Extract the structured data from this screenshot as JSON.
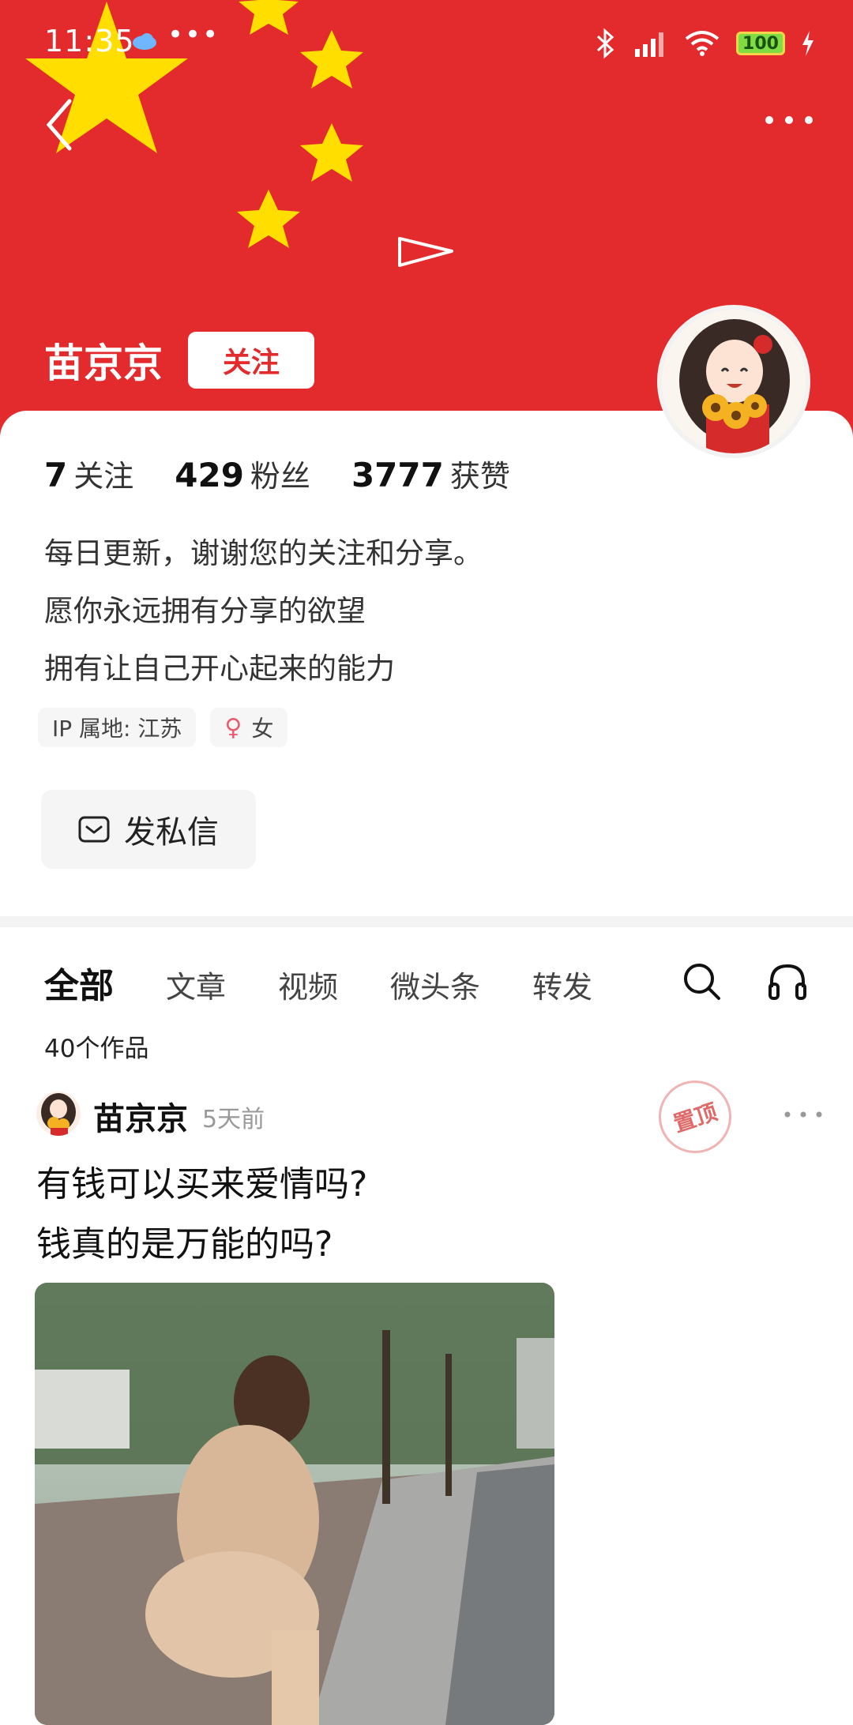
{
  "status_bar": {
    "time": "11:35",
    "dots": "•••",
    "battery": "100"
  },
  "profile": {
    "name": "苗京京",
    "follow_label": "关注",
    "stats": [
      {
        "count": "7",
        "label": "关注"
      },
      {
        "count": "429",
        "label": "粉丝"
      },
      {
        "count": "3777",
        "label": "获赞"
      }
    ],
    "bio": [
      "每日更新，谢谢您的关注和分享。",
      "愿你永远拥有分享的欲望",
      "拥有让自己开心起来的能力"
    ],
    "ip_location": "IP 属地: 江苏",
    "gender": "女",
    "gender_symbol": "♀",
    "dm_label": "发私信"
  },
  "tabs": [
    {
      "label": "全部",
      "active": true
    },
    {
      "label": "文章"
    },
    {
      "label": "视频"
    },
    {
      "label": "微头条"
    },
    {
      "label": "转发"
    }
  ],
  "works_count": "40个作品",
  "post": {
    "author": "苗京京",
    "time": "5天前",
    "pin_label": "置顶",
    "text_lines": [
      "有钱可以买来爱情吗?",
      "钱真的是万能的吗?"
    ]
  },
  "colors": {
    "banner_red": "#e32a2c",
    "star_yellow": "#ffde00",
    "pin_red": "#e06a6a"
  },
  "icons": [
    "back-icon",
    "more-icon",
    "share-icon",
    "envelope-icon",
    "search-icon",
    "headphones-icon",
    "bluetooth-icon",
    "signal-icon",
    "wifi-icon",
    "battery-icon",
    "charging-icon",
    "cloud-icon"
  ]
}
